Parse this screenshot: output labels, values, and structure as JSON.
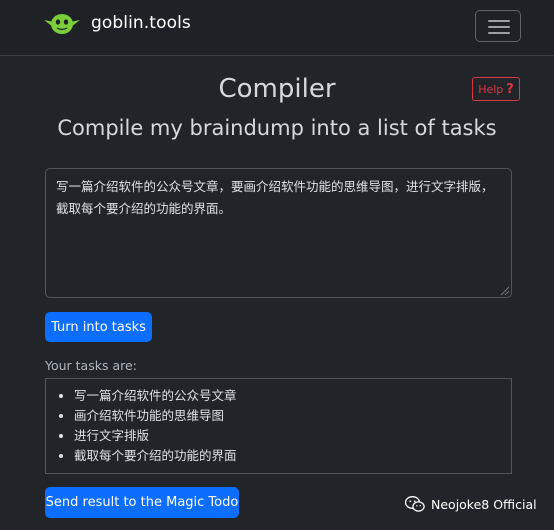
{
  "navbar": {
    "brand": "goblin.tools",
    "logo_icon": "goblin-head-icon",
    "menu_icon": "hamburger-menu-icon"
  },
  "header": {
    "title": "Compiler",
    "subtitle": "Compile my braindump into a list of tasks",
    "help_label": "Help",
    "help_icon": "question-mark-icon"
  },
  "input": {
    "value": "写一篇介绍软件的公众号文章，要画介绍软件功能的思维导图，进行文字排版，截取每个要介绍的功能的界面。"
  },
  "actions": {
    "turn_into_tasks": "Turn into tasks",
    "send_result": "Send result to the Magic Todo"
  },
  "results": {
    "label": "Your tasks are:",
    "tasks": [
      "写一篇介绍软件的公众号文章",
      "画介绍软件功能的思维导图",
      "进行文字排版",
      "截取每个要介绍的功能的界面"
    ]
  },
  "watermark": {
    "text": "Neojoke8 Official",
    "icon": "wechat-icon"
  },
  "colors": {
    "background": "#212529",
    "primary": "#0d6efd",
    "danger": "#dc3545",
    "goblin_green": "#7ccd3a"
  }
}
